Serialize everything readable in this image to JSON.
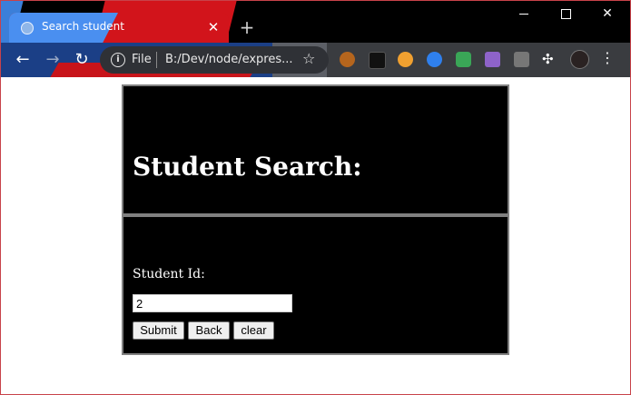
{
  "browser": {
    "tab_title": "Search student",
    "new_tab_symbol": "+",
    "scheme_label": "File",
    "url": "B:/Dev/node/expres...",
    "window_controls": {
      "minimize": "minimize",
      "maximize": "maximize",
      "close": "✕"
    }
  },
  "page": {
    "heading": "Student Search:",
    "student_id_label": "Student Id:",
    "student_id_value": "2",
    "buttons": {
      "submit": "Submit",
      "back": "Back",
      "clear": "clear"
    }
  },
  "icons": [
    "globe-icon",
    "close-icon",
    "back-arrow-icon",
    "forward-arrow-icon",
    "reload-icon",
    "info-icon",
    "star-icon",
    "puzzle-icon",
    "kebab-menu-icon"
  ]
}
